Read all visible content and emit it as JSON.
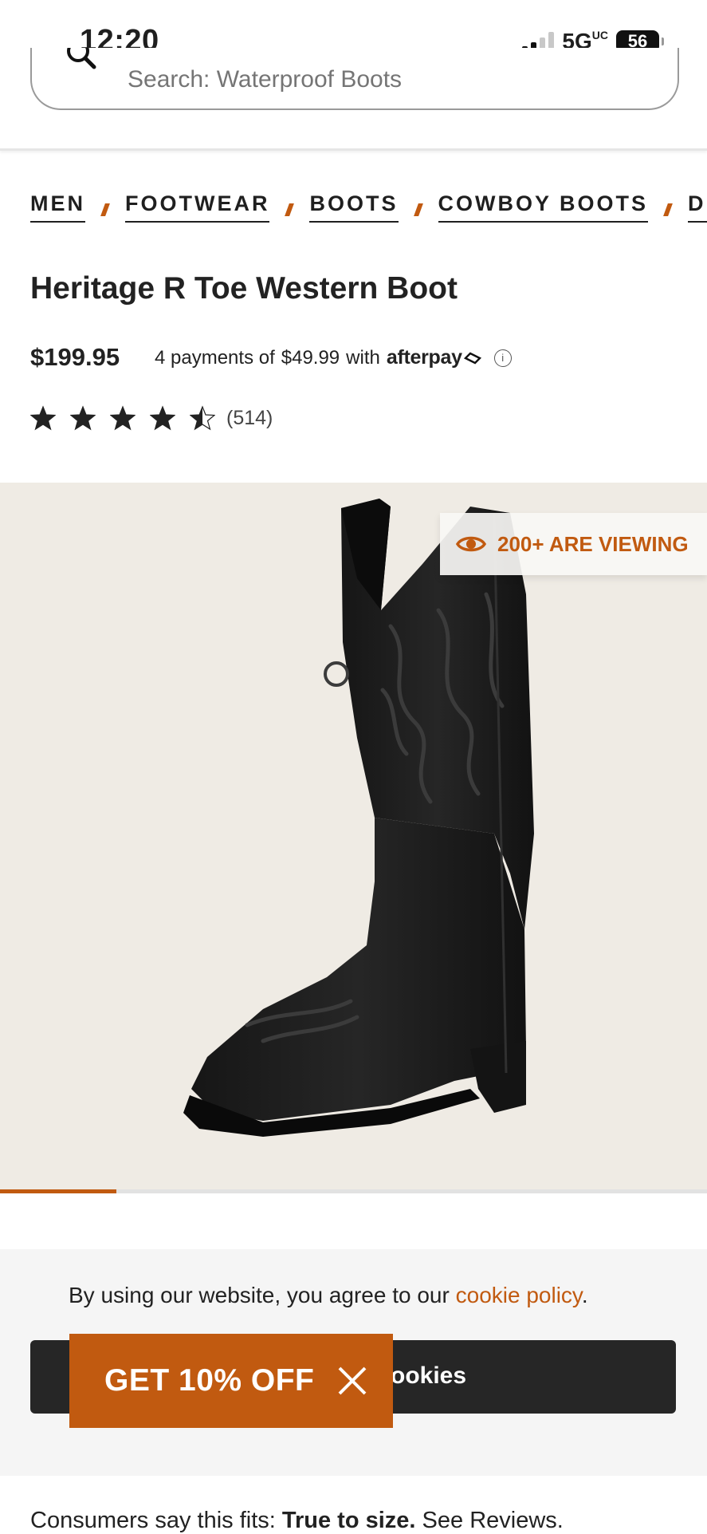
{
  "status": {
    "time": "12:20",
    "network": "5G",
    "network_suffix": "UC",
    "battery": "56"
  },
  "search": {
    "placeholder": "Search: Waterproof Boots"
  },
  "breadcrumb": [
    "MEN",
    "FOOTWEAR",
    "BOOTS",
    "COWBOY BOOTS",
    "DRI"
  ],
  "product": {
    "title": "Heritage R Toe Western Boot",
    "price": "$199.95",
    "installment_prefix": "4 payments of",
    "installment_amount": "$49.99",
    "installment_with": "with",
    "afterpay_brand": "afterpay",
    "rating_value": 4.5,
    "rating_max": 5,
    "review_count": "(514)"
  },
  "gallery": {
    "viewing_badge": "200+ ARE VIEWING",
    "progress_fraction": 0.165
  },
  "cookie": {
    "text_prefix": "By using our website, you agree to our ",
    "link": "cookie policy",
    "text_suffix": ".",
    "button_label": "ookies"
  },
  "promo": {
    "label": "GET 10% OFF"
  },
  "fit": {
    "prefix": "Consumers say this fits: ",
    "value": "True to size.",
    "link": " See Reviews."
  },
  "colors": {
    "accent": "#c15a10",
    "dark": "#262626",
    "hero_bg": "#efebe4"
  }
}
